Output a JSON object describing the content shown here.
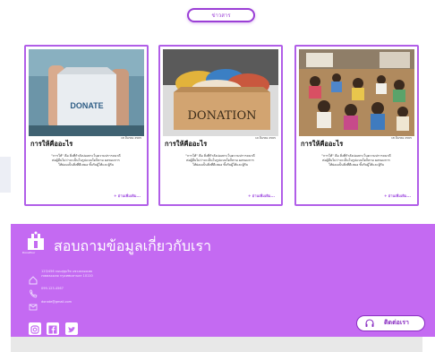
{
  "header": {
    "news_button_label": "ข่าวสาร"
  },
  "cards": [
    {
      "date": "18 มีนาคม 2565",
      "title": "การให้คือ​อะไร",
      "body": "\"การให้\" คือ สิ่งที่กำลังบ่มเพาะในความปรารถนาดีต่อผู้อื่นไม่ว่าจะเป็นในรูปแบบใดก็ตาม ผลของการให้ย่อมเป็นสิ่งที่ดีเสมอ ทั้งกับผู้ให้และผู้รับ",
      "more": "+ อ่านเพิ่มเติม...",
      "image_label": "DONATE"
    },
    {
      "date": "19 มีนาคม 2565",
      "title": "การให้คือ​อะไร",
      "body": "\"การให้\" คือ สิ่งที่กำลังบ่มเพาะในความปรารถนาดีต่อผู้อื่นไม่ว่าจะเป็นในรูปแบบใดก็ตาม ผลของการให้ย่อมเป็นสิ่งที่ดีเสมอ ทั้งกับผู้ให้และผู้รับ",
      "more": "+ อ่านเพิ่มเติม...",
      "image_label": "DONATION"
    },
    {
      "date": "18 มีนาคม 2565",
      "title": "การให้คือ​อะไร",
      "body": "\"การให้\" คือ สิ่งที่กำลังบ่มเพาะในความปรารถนาดีต่อผู้อื่นไม่ว่าจะเป็นในรูปแบบใดก็ตาม ผลของการให้ย่อมเป็นสิ่งที่ดีเสมอ ทั้งกับผู้ให้และผู้รับ",
      "more": "+ อ่านเพิ่มเติม...",
      "image_label": ""
    }
  ],
  "contact": {
    "logo_text": "DonaTour",
    "title": "สอบถามข้อมูลเกี่ยวกับเรา",
    "address_line1": "123/456 ถนนสุขุมวิท แขวงคลองเตย",
    "address_line2": "เขตคลองเตย กรุงเทพมหานคร 10110",
    "phone": "099-123-4567",
    "email": "donate@gmail.com",
    "contact_button_label": "ติดต่อเรา"
  },
  "colors": {
    "accent": "#b15ee8",
    "footer_bg": "#c46af2",
    "button_text": "#8a2fc2"
  },
  "icons": [
    "home-icon",
    "phone-icon",
    "mail-icon",
    "instagram-icon",
    "facebook-icon",
    "twitter-icon",
    "headset-icon"
  ]
}
